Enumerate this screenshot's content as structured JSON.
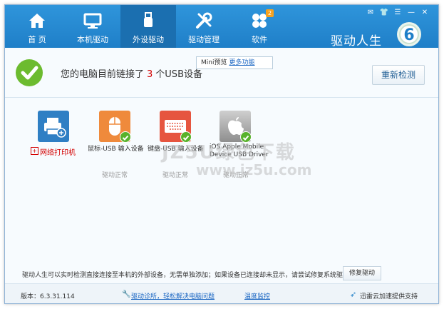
{
  "nav": {
    "tabs": [
      {
        "label": "首 页",
        "icon": "home-icon"
      },
      {
        "label": "本机驱动",
        "icon": "monitor-icon"
      },
      {
        "label": "外设驱动",
        "icon": "usb-icon"
      },
      {
        "label": "驱动管理",
        "icon": "tools-icon"
      },
      {
        "label": "软件",
        "icon": "apps-icon",
        "badge": "2"
      }
    ],
    "active_index": 2,
    "brand": "驱动人生",
    "logo_digit": "6"
  },
  "status": {
    "prefix": "您的电脑目前链接了",
    "count": "3",
    "suffix": "个USB设备",
    "rescan_label": "重新检测"
  },
  "tooltip": {
    "text": "Mini预览",
    "link": "更多功能"
  },
  "devices": [
    {
      "name": "网络打印机",
      "icon": "printer-icon",
      "status": ""
    },
    {
      "name": "鼠标-USB 输入设备",
      "icon": "mouse-icon",
      "status": "驱动正常"
    },
    {
      "name": "键盘-USB 输入设备",
      "icon": "keyboard-icon",
      "status": "驱动正常"
    },
    {
      "name": "iOS Apple Mobile Device USB Driver",
      "name_line1": "iOS Apple Mobile",
      "name_line2": "Device USB Driver",
      "icon": "apple-icon",
      "status": "驱动正常"
    }
  ],
  "watermark": {
    "line1": "JZ5U绿色下载",
    "line2": "www.jz5u.com"
  },
  "info": {
    "text": "驱动人生可以实时检测直接连接至本机的外部设备，无需单独添加；如果设备已连接却未显示，请尝试修复系统驱动:",
    "repair_label": "修复驱动"
  },
  "footer": {
    "version": "版本：6.3.31.114",
    "diagnose": "驱动诊所，轻松解决电脑问题",
    "temp": "温度监控",
    "thunder": "迅雷云加速提供支持"
  },
  "colors": {
    "topbar": "#2585d0",
    "active_tab": "#1b6fb0",
    "check": "#6cbb2f",
    "count": "#d40000",
    "link": "#1a66c3"
  }
}
